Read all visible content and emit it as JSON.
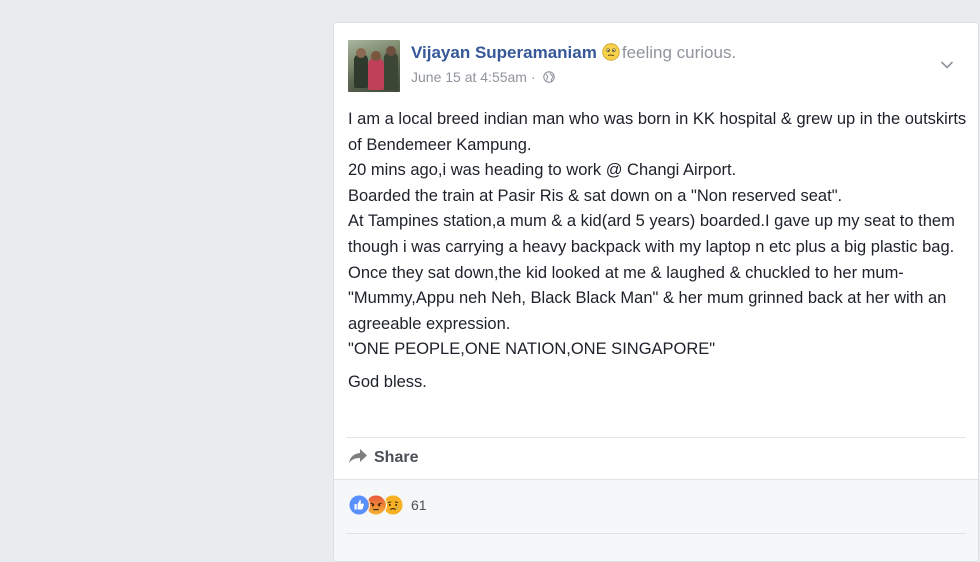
{
  "post": {
    "author_name": "Vijayan Superamaniam",
    "feeling_text": "feeling curious.",
    "timestamp": "June 15 at 4:55am",
    "separator": " · ",
    "paragraphs": [
      "I am a local breed indian man who was born in KK hospital & grew up in the outskirts of Bendemeer Kampung.",
      "20 mins ago,i was heading to work @ Changi Airport.",
      "Boarded the train at Pasir Ris & sat down on a \"Non reserved seat\".",
      "At Tampines station,a mum & a kid(ard 5 years) boarded.I gave up my seat to them though i was carrying a heavy backpack with my laptop n etc plus a big plastic bag.",
      "Once they sat down,the kid looked at me & laughed & chuckled to her mum-\"Mummy,Appu neh Neh, Black Black Man\" & her mum grinned back at her with an agreeable expression.",
      "\"ONE PEOPLE,ONE NATION,ONE SINGAPORE\""
    ],
    "closing": "God bless."
  },
  "actions": {
    "share_label": "Share"
  },
  "reactions": {
    "count": "61",
    "types": [
      "like-icon",
      "angry-icon",
      "sad-icon"
    ]
  },
  "icons": {
    "feeling": "confused-face-icon",
    "privacy": "globe-icon",
    "menu": "chevron-down-icon",
    "share": "share-arrow-icon"
  },
  "colors": {
    "link": "#365899",
    "meta": "#90949c",
    "text": "#1d2129",
    "like_blue": "#5890ff",
    "angry_red": "#e9573f",
    "sad_yellow": "#f7b125"
  }
}
